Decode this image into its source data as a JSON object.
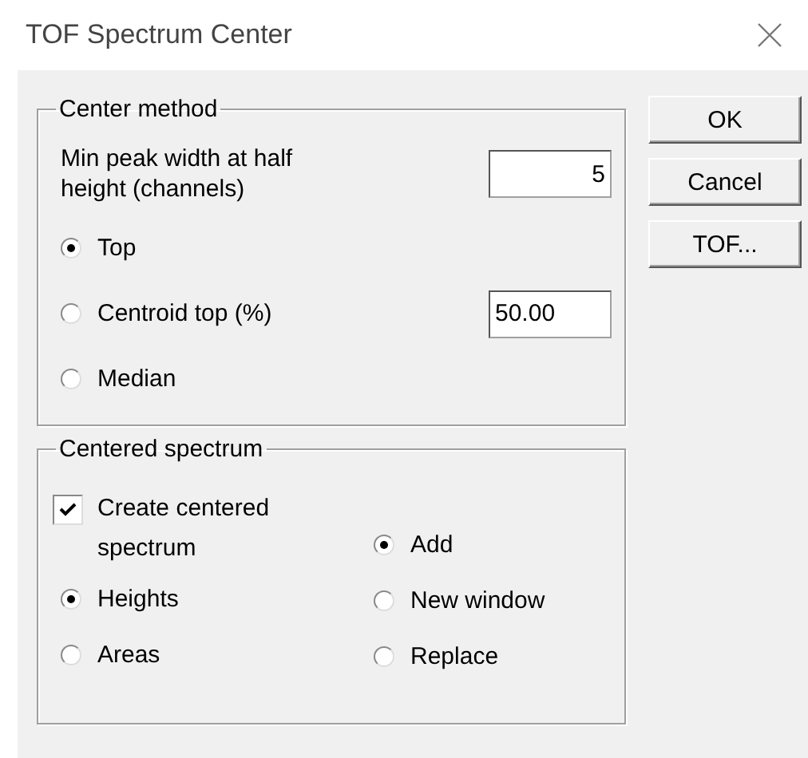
{
  "window": {
    "title": "TOF Spectrum Center"
  },
  "center_method": {
    "title": "Center method",
    "min_peak_width": {
      "label": "Min peak width at half height (channels)",
      "value": "5"
    },
    "options": [
      {
        "label": "Top",
        "selected": true
      },
      {
        "label": "Centroid top (%)",
        "selected": false,
        "value": "50.00"
      },
      {
        "label": "Median",
        "selected": false
      }
    ]
  },
  "centered_spectrum": {
    "title": "Centered spectrum",
    "create": {
      "label": "Create centered spectrum",
      "checked": true
    },
    "measure": [
      {
        "label": "Heights",
        "selected": true
      },
      {
        "label": "Areas",
        "selected": false
      }
    ],
    "output": [
      {
        "label": "Add",
        "selected": true
      },
      {
        "label": "New window",
        "selected": false
      },
      {
        "label": "Replace",
        "selected": false
      }
    ]
  },
  "buttons": [
    "OK",
    "Cancel",
    "TOF..."
  ]
}
